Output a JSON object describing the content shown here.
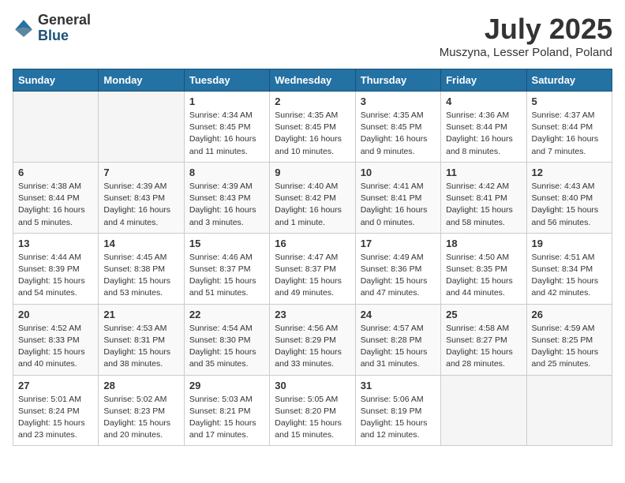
{
  "header": {
    "logo_general": "General",
    "logo_blue": "Blue",
    "title": "July 2025",
    "subtitle": "Muszyna, Lesser Poland, Poland"
  },
  "weekdays": [
    "Sunday",
    "Monday",
    "Tuesday",
    "Wednesday",
    "Thursday",
    "Friday",
    "Saturday"
  ],
  "weeks": [
    [
      {
        "day": "",
        "empty": true
      },
      {
        "day": "",
        "empty": true
      },
      {
        "day": "1",
        "sunrise": "Sunrise: 4:34 AM",
        "sunset": "Sunset: 8:45 PM",
        "daylight": "Daylight: 16 hours and 11 minutes."
      },
      {
        "day": "2",
        "sunrise": "Sunrise: 4:35 AM",
        "sunset": "Sunset: 8:45 PM",
        "daylight": "Daylight: 16 hours and 10 minutes."
      },
      {
        "day": "3",
        "sunrise": "Sunrise: 4:35 AM",
        "sunset": "Sunset: 8:45 PM",
        "daylight": "Daylight: 16 hours and 9 minutes."
      },
      {
        "day": "4",
        "sunrise": "Sunrise: 4:36 AM",
        "sunset": "Sunset: 8:44 PM",
        "daylight": "Daylight: 16 hours and 8 minutes."
      },
      {
        "day": "5",
        "sunrise": "Sunrise: 4:37 AM",
        "sunset": "Sunset: 8:44 PM",
        "daylight": "Daylight: 16 hours and 7 minutes."
      }
    ],
    [
      {
        "day": "6",
        "sunrise": "Sunrise: 4:38 AM",
        "sunset": "Sunset: 8:44 PM",
        "daylight": "Daylight: 16 hours and 5 minutes."
      },
      {
        "day": "7",
        "sunrise": "Sunrise: 4:39 AM",
        "sunset": "Sunset: 8:43 PM",
        "daylight": "Daylight: 16 hours and 4 minutes."
      },
      {
        "day": "8",
        "sunrise": "Sunrise: 4:39 AM",
        "sunset": "Sunset: 8:43 PM",
        "daylight": "Daylight: 16 hours and 3 minutes."
      },
      {
        "day": "9",
        "sunrise": "Sunrise: 4:40 AM",
        "sunset": "Sunset: 8:42 PM",
        "daylight": "Daylight: 16 hours and 1 minute."
      },
      {
        "day": "10",
        "sunrise": "Sunrise: 4:41 AM",
        "sunset": "Sunset: 8:41 PM",
        "daylight": "Daylight: 16 hours and 0 minutes."
      },
      {
        "day": "11",
        "sunrise": "Sunrise: 4:42 AM",
        "sunset": "Sunset: 8:41 PM",
        "daylight": "Daylight: 15 hours and 58 minutes."
      },
      {
        "day": "12",
        "sunrise": "Sunrise: 4:43 AM",
        "sunset": "Sunset: 8:40 PM",
        "daylight": "Daylight: 15 hours and 56 minutes."
      }
    ],
    [
      {
        "day": "13",
        "sunrise": "Sunrise: 4:44 AM",
        "sunset": "Sunset: 8:39 PM",
        "daylight": "Daylight: 15 hours and 54 minutes."
      },
      {
        "day": "14",
        "sunrise": "Sunrise: 4:45 AM",
        "sunset": "Sunset: 8:38 PM",
        "daylight": "Daylight: 15 hours and 53 minutes."
      },
      {
        "day": "15",
        "sunrise": "Sunrise: 4:46 AM",
        "sunset": "Sunset: 8:37 PM",
        "daylight": "Daylight: 15 hours and 51 minutes."
      },
      {
        "day": "16",
        "sunrise": "Sunrise: 4:47 AM",
        "sunset": "Sunset: 8:37 PM",
        "daylight": "Daylight: 15 hours and 49 minutes."
      },
      {
        "day": "17",
        "sunrise": "Sunrise: 4:49 AM",
        "sunset": "Sunset: 8:36 PM",
        "daylight": "Daylight: 15 hours and 47 minutes."
      },
      {
        "day": "18",
        "sunrise": "Sunrise: 4:50 AM",
        "sunset": "Sunset: 8:35 PM",
        "daylight": "Daylight: 15 hours and 44 minutes."
      },
      {
        "day": "19",
        "sunrise": "Sunrise: 4:51 AM",
        "sunset": "Sunset: 8:34 PM",
        "daylight": "Daylight: 15 hours and 42 minutes."
      }
    ],
    [
      {
        "day": "20",
        "sunrise": "Sunrise: 4:52 AM",
        "sunset": "Sunset: 8:33 PM",
        "daylight": "Daylight: 15 hours and 40 minutes."
      },
      {
        "day": "21",
        "sunrise": "Sunrise: 4:53 AM",
        "sunset": "Sunset: 8:31 PM",
        "daylight": "Daylight: 15 hours and 38 minutes."
      },
      {
        "day": "22",
        "sunrise": "Sunrise: 4:54 AM",
        "sunset": "Sunset: 8:30 PM",
        "daylight": "Daylight: 15 hours and 35 minutes."
      },
      {
        "day": "23",
        "sunrise": "Sunrise: 4:56 AM",
        "sunset": "Sunset: 8:29 PM",
        "daylight": "Daylight: 15 hours and 33 minutes."
      },
      {
        "day": "24",
        "sunrise": "Sunrise: 4:57 AM",
        "sunset": "Sunset: 8:28 PM",
        "daylight": "Daylight: 15 hours and 31 minutes."
      },
      {
        "day": "25",
        "sunrise": "Sunrise: 4:58 AM",
        "sunset": "Sunset: 8:27 PM",
        "daylight": "Daylight: 15 hours and 28 minutes."
      },
      {
        "day": "26",
        "sunrise": "Sunrise: 4:59 AM",
        "sunset": "Sunset: 8:25 PM",
        "daylight": "Daylight: 15 hours and 25 minutes."
      }
    ],
    [
      {
        "day": "27",
        "sunrise": "Sunrise: 5:01 AM",
        "sunset": "Sunset: 8:24 PM",
        "daylight": "Daylight: 15 hours and 23 minutes."
      },
      {
        "day": "28",
        "sunrise": "Sunrise: 5:02 AM",
        "sunset": "Sunset: 8:23 PM",
        "daylight": "Daylight: 15 hours and 20 minutes."
      },
      {
        "day": "29",
        "sunrise": "Sunrise: 5:03 AM",
        "sunset": "Sunset: 8:21 PM",
        "daylight": "Daylight: 15 hours and 17 minutes."
      },
      {
        "day": "30",
        "sunrise": "Sunrise: 5:05 AM",
        "sunset": "Sunset: 8:20 PM",
        "daylight": "Daylight: 15 hours and 15 minutes."
      },
      {
        "day": "31",
        "sunrise": "Sunrise: 5:06 AM",
        "sunset": "Sunset: 8:19 PM",
        "daylight": "Daylight: 15 hours and 12 minutes."
      },
      {
        "day": "",
        "empty": true
      },
      {
        "day": "",
        "empty": true
      }
    ]
  ]
}
